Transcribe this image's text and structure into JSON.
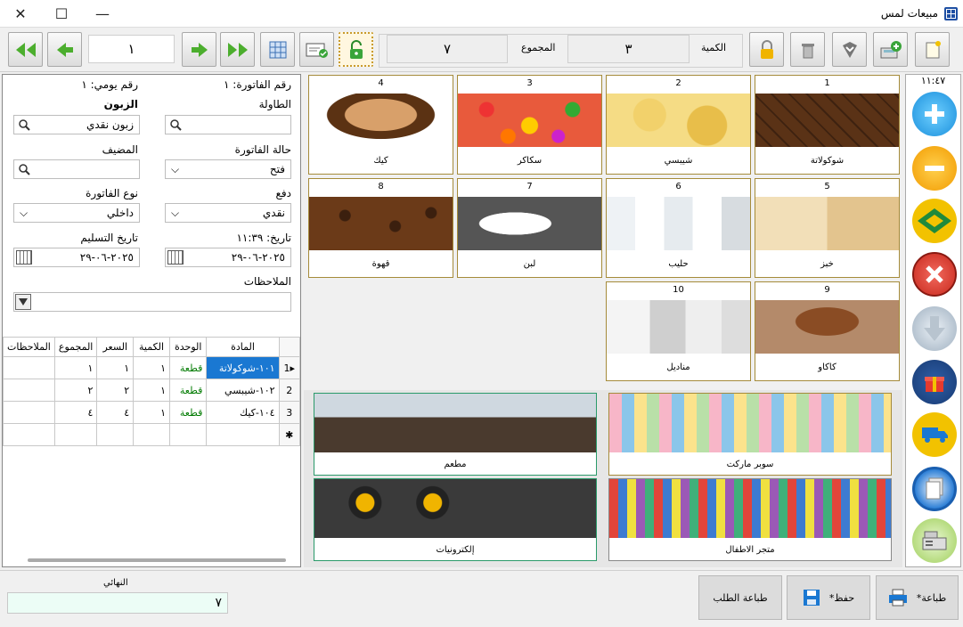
{
  "window": {
    "title": "مبيعات لمس"
  },
  "toolbar": {
    "page_number": "١",
    "quantity_label": "الكمية",
    "quantity_value": "٣",
    "total_label": "المجموع",
    "total_value": "٧"
  },
  "invoice": {
    "invoice_number_label": "رقم الفاتورة: ١",
    "daily_number_label": "رقم يومي: ١",
    "table_label": "الطاولة",
    "customer_label": "الزبون",
    "customer_value": "زبون نقدي",
    "status_label": "حالة الفاتورة",
    "status_value": "فتح",
    "host_label": "المضيف",
    "payment_label": "دفع",
    "payment_value": "نقدي",
    "type_label": "نوع الفاتورة",
    "type_value": "داخلي",
    "date_label": "تاريخ: ١١:٣٩",
    "date_value": "٢٠٢٥-٠٦-٢٩",
    "delivery_label": "تاريخ التسليم",
    "delivery_value": "٢٠٢٥-٠٦-٢٩",
    "notes_label": "الملاحظات"
  },
  "grid": {
    "headers": [
      "المادة",
      "الوحدة",
      "الكمية",
      "السعر",
      "المجموع",
      "الملاحظات"
    ],
    "rows": [
      {
        "num": "1",
        "item": "١٠١-شوكولاتة",
        "unit": "قطعة",
        "qty": "١",
        "price": "١",
        "total": "١"
      },
      {
        "num": "2",
        "item": "١٠٢-شيبسي",
        "unit": "قطعة",
        "qty": "١",
        "price": "٢",
        "total": "٢"
      },
      {
        "num": "3",
        "item": "١٠٤-كيك",
        "unit": "قطعة",
        "qty": "١",
        "price": "٤",
        "total": "٤"
      }
    ]
  },
  "products": [
    {
      "num": "1",
      "name": "شوكولاتة"
    },
    {
      "num": "2",
      "name": "شيبسي"
    },
    {
      "num": "3",
      "name": "سكاكر"
    },
    {
      "num": "4",
      "name": "كيك"
    },
    {
      "num": "5",
      "name": "خبز"
    },
    {
      "num": "6",
      "name": "حليب"
    },
    {
      "num": "7",
      "name": "لبن"
    },
    {
      "num": "8",
      "name": "قهوة"
    },
    {
      "num": "9",
      "name": "كاكاو"
    },
    {
      "num": "10",
      "name": "مناديل"
    }
  ],
  "categories": [
    {
      "name": "سوبر ماركت"
    },
    {
      "name": "مطعم"
    },
    {
      "name": "متجر الاطفال"
    },
    {
      "name": "إلكترونيات"
    }
  ],
  "side": {
    "clock": "١١:٤٧"
  },
  "bottom": {
    "final_label": "النهائي",
    "final_value": "٧",
    "print_label": "طباعة*",
    "save_label": "حفظ*",
    "print_order_label": "طباعة الطلب"
  },
  "colors": {
    "accent_blue": "#1a78d2",
    "tile_border": "#a58b3a",
    "unit_green": "#007a00"
  }
}
